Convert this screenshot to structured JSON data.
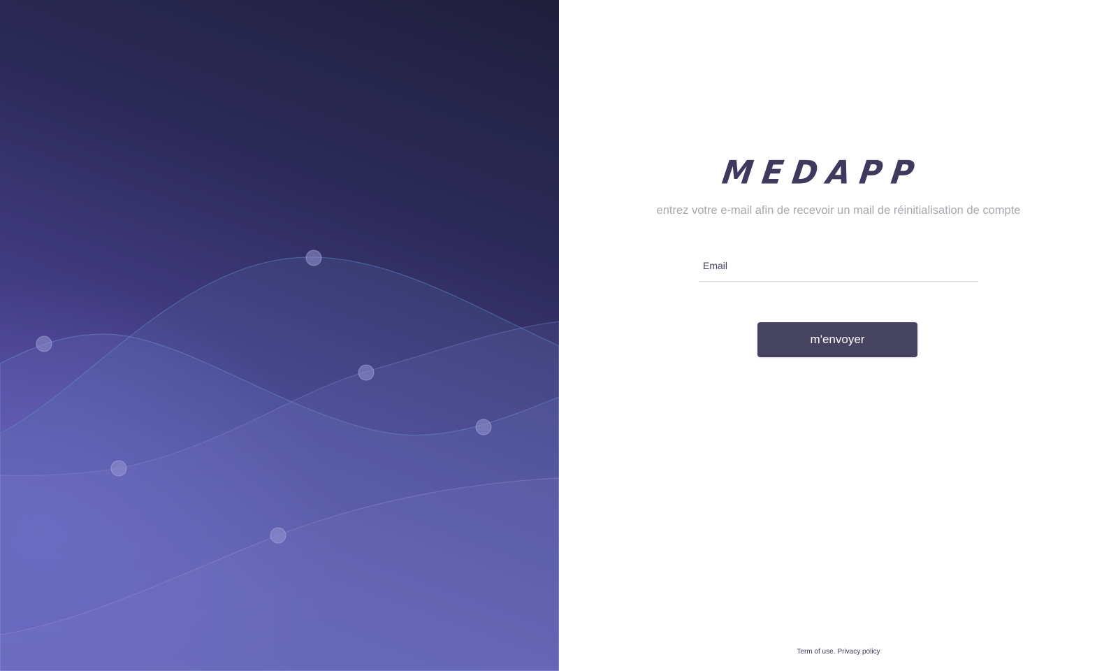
{
  "brand": {
    "logo_text": "MEDAPP"
  },
  "form": {
    "instruction": "entrez votre e-mail afin de recevoir un mail de réinitialisation de compte",
    "email_placeholder": "Email",
    "email_value": "",
    "submit_label": "m'envoyer"
  },
  "footer": {
    "terms_label": "Term of use.",
    "privacy_label": "Privacy policy"
  },
  "colors": {
    "brand_dark": "#45435f",
    "panel_gradient_top": "#1f1f3c",
    "panel_gradient_bottom": "#5d56ad"
  }
}
